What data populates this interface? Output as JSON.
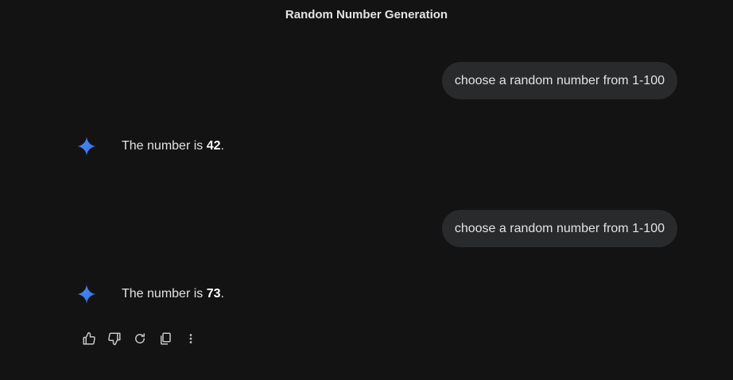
{
  "conversation": {
    "title": "Random Number Generation"
  },
  "messages": [
    {
      "role": "user",
      "text": "choose a random number from 1-100"
    },
    {
      "role": "model",
      "prefix": "The number is ",
      "value": "42",
      "suffix": "."
    },
    {
      "role": "user",
      "text": "choose a random number from 1-100"
    },
    {
      "role": "model",
      "prefix": "The number is ",
      "value": "73",
      "suffix": "."
    }
  ],
  "response_actions": [
    {
      "icon": "thumbs-up-icon"
    },
    {
      "icon": "thumbs-down-icon"
    },
    {
      "icon": "regenerate-icon"
    },
    {
      "icon": "copy-icon"
    },
    {
      "icon": "more-vert-icon"
    }
  ],
  "colors": {
    "background": "#131314",
    "user_bubble": "#282a2c",
    "text": "#e3e3e3",
    "spark_blue": "#4285f4"
  }
}
